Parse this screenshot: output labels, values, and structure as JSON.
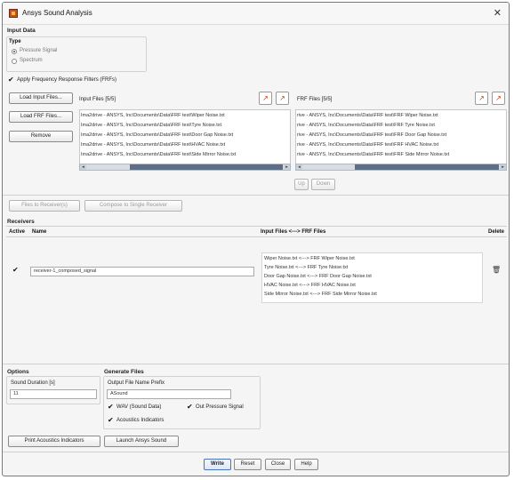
{
  "window": {
    "title": "Ansys Sound Analysis"
  },
  "input_data": {
    "heading": "Input Data",
    "type_label": "Type",
    "type_options": [
      "Pressure Signal",
      "Spectrum"
    ],
    "apply_frf_label": "Apply Frequency Response Filters (FRFs)",
    "load_input_files_button": "Load Input Files...",
    "load_frf_files_button": "Load FRF Files...",
    "remove_button": "Remove",
    "input_files_label": "Input Files [5/5]",
    "frf_files_label": "FRF Files [5/5]",
    "input_files": [
      "Ima2drive - ANSYS, Inc\\Documents\\Data\\FRF test\\Wiper Noise.txt",
      "Ima2drive - ANSYS, Inc\\Documents\\Data\\FRF test\\Tyre Noise.txt",
      "Ima2drive - ANSYS, Inc\\Documents\\Data\\FRF test\\Door Gap Noise.txt",
      "Ima2drive - ANSYS, Inc\\Documents\\Data\\FRF test\\HVAC Noise.txt",
      "Ima2drive - ANSYS, Inc\\Documents\\Data\\FRF test\\Side Mirror Noise.txt"
    ],
    "frf_files": [
      "rive - ANSYS, Inc\\Documents\\Data\\FRF test\\FRF Wiper Noise.txt",
      "rive - ANSYS, Inc\\Documents\\Data\\FRF test\\FRF Tyre Noise.txt",
      "rive - ANSYS, Inc\\Documents\\Data\\FRF test\\FRF Door Gap Noise.txt",
      "rive - ANSYS, Inc\\Documents\\Data\\FRF test\\FRF HVAC Noise.txt",
      "rive - ANSYS, Inc\\Documents\\Data\\FRF test\\FRF Side Mirror Noise.txt"
    ],
    "up_button": "Up",
    "down_button": "Down",
    "files_to_receivers_button": "Files to Receiver(s)",
    "compose_button": "Compose to Single Receiver"
  },
  "receivers": {
    "heading": "Receivers",
    "columns": {
      "active": "Active",
      "name": "Name",
      "files": "Input Files <---> FRF Files",
      "delete": "Delete"
    },
    "row": {
      "active_mark": "✔",
      "name": "receiver-1_composed_signal",
      "pairs": [
        "Wiper Noise.txt <---> FRF Wiper Noise.txt",
        "Tyre Noise.txt <---> FRF Tyre Noise.txt",
        "Door Gap Noise.txt <---> FRF Door Gap Noise.txt",
        "HVAC Noise.txt <---> FRF HVAC Noise.txt",
        "Side Mirror Noise.txt <---> FRF Side Mirror Noise.txt"
      ]
    }
  },
  "options": {
    "heading": "Options",
    "sound_duration_label": "Sound Duration [s]",
    "sound_duration_value": "11"
  },
  "generate_files": {
    "heading": "Generate Files",
    "prefix_label": "Output File Name Prefix",
    "prefix_value": "ASound",
    "wav_label": "WAV (Sound Data)",
    "out_pressure_label": "Out Pressure Signal",
    "acoustics_label": "Acoustics Indicators"
  },
  "print_acoustics_button": "Print Acoustics Indicators",
  "launch_button": "Launch Ansys Sound",
  "footer": {
    "write": "Write",
    "reset": "Reset",
    "close": "Close",
    "help": "Help"
  },
  "icons": {
    "check": "✔",
    "close": "✕",
    "arrow_left": "◂",
    "arrow_right": "▸",
    "add_file": "↗",
    "delete": "🗑"
  }
}
